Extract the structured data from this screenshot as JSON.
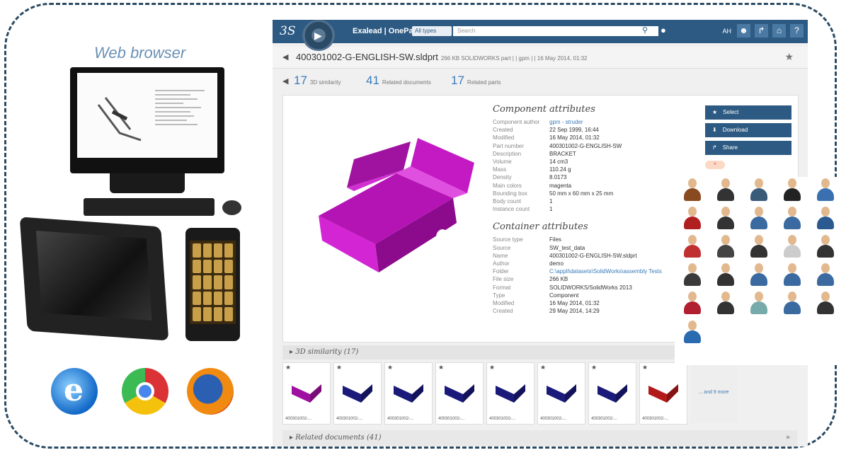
{
  "left": {
    "web_browser_label": "Web browser",
    "devices": [
      "desktop-monitor",
      "tablet",
      "smartphone"
    ],
    "browser_icons": [
      "internet-explorer-icon",
      "chrome-icon",
      "firefox-icon"
    ]
  },
  "topbar": {
    "brand": "Exalead | OnePart",
    "scope": "All types",
    "search_placeholder": "Search",
    "user": "AH",
    "icons": [
      "user-icon",
      "share-icon",
      "home-icon",
      "help-icon"
    ]
  },
  "title": {
    "text": "400301002-G-ENGLISH-SW.sldprt",
    "meta": "266 KB SOLIDWORKS part | | gpm | | 16 May 2014, 01:32"
  },
  "tabs": [
    {
      "count": "17",
      "label": "3D similarity"
    },
    {
      "count": "41",
      "label": "Related documents"
    },
    {
      "count": "17",
      "label": "Related parts"
    }
  ],
  "component": {
    "heading": "Component attributes",
    "rows": [
      {
        "k": "Component author",
        "v": "gpm - struder",
        "link": true
      },
      {
        "k": "Created",
        "v": "22 Sep 1999, 16:44",
        "link": false
      },
      {
        "k": "Modified",
        "v": "16 May 2014, 01:32",
        "link": false
      },
      {
        "k": "Part number",
        "v": "400301002-G-ENGLISH-SW",
        "link": false
      },
      {
        "k": "Description",
        "v": "BRACKET",
        "link": false
      },
      {
        "k": "Volume",
        "v": "14 cm3",
        "link": false
      },
      {
        "k": "Mass",
        "v": "110.24 g",
        "link": false
      },
      {
        "k": "Density",
        "v": "8.0173",
        "link": false
      },
      {
        "k": "Main colors",
        "v": "magenta",
        "link": false
      },
      {
        "k": "Bounding box",
        "v": "50 mm x 60 mm x 25 mm",
        "link": false
      },
      {
        "k": "Body count",
        "v": "1",
        "link": false
      },
      {
        "k": "Instance count",
        "v": "1",
        "link": false
      }
    ]
  },
  "container": {
    "heading": "Container attributes",
    "rows": [
      {
        "k": "Source type",
        "v": "Files",
        "link": false
      },
      {
        "k": "Source",
        "v": "SW_test_data",
        "link": false
      },
      {
        "k": "Name",
        "v": "400301002-G-ENGLISH-SW.sldprt",
        "link": false
      },
      {
        "k": "Author",
        "v": "demo",
        "link": false
      },
      {
        "k": "Folder",
        "v": "C:\\appli\\datasets\\SolidWorks\\assembly Tests",
        "link": true
      },
      {
        "k": "File size",
        "v": "266 KB",
        "link": false
      },
      {
        "k": "Format",
        "v": "SOLIDWORKS/SolidWorks 2013",
        "link": false
      },
      {
        "k": "Type",
        "v": "Component",
        "link": false
      },
      {
        "k": "Modified",
        "v": "16 May 2014, 01:32",
        "link": false
      },
      {
        "k": "Created",
        "v": "29 May 2014, 14:29",
        "link": false
      }
    ]
  },
  "actions": [
    {
      "icon": "star-icon",
      "glyph": "★",
      "label": "Select"
    },
    {
      "icon": "download-icon",
      "glyph": "⬇",
      "label": "Download"
    },
    {
      "icon": "share-icon",
      "glyph": "↱",
      "label": "Share"
    }
  ],
  "tag": "×",
  "similarity": {
    "heading": "3D similarity (17)",
    "thumbs": [
      {
        "label": "400301002-...",
        "color": "#a010a0"
      },
      {
        "label": "400301002-...",
        "color": "#1a1a7a"
      },
      {
        "label": "400301002-...",
        "color": "#1a1a7a"
      },
      {
        "label": "400301002-...",
        "color": "#1a1a7a"
      },
      {
        "label": "400301002-...",
        "color": "#1a1a7a"
      },
      {
        "label": "400301002-...",
        "color": "#1a1a7a"
      },
      {
        "label": "400301002-...",
        "color": "#1a1a7a"
      },
      {
        "label": "400301002-...",
        "color": "#b21a1a"
      }
    ],
    "more": "... and 9 more"
  },
  "related": {
    "heading": "Related documents (41)",
    "arrow": "»"
  },
  "avatars": {
    "count": 26
  }
}
